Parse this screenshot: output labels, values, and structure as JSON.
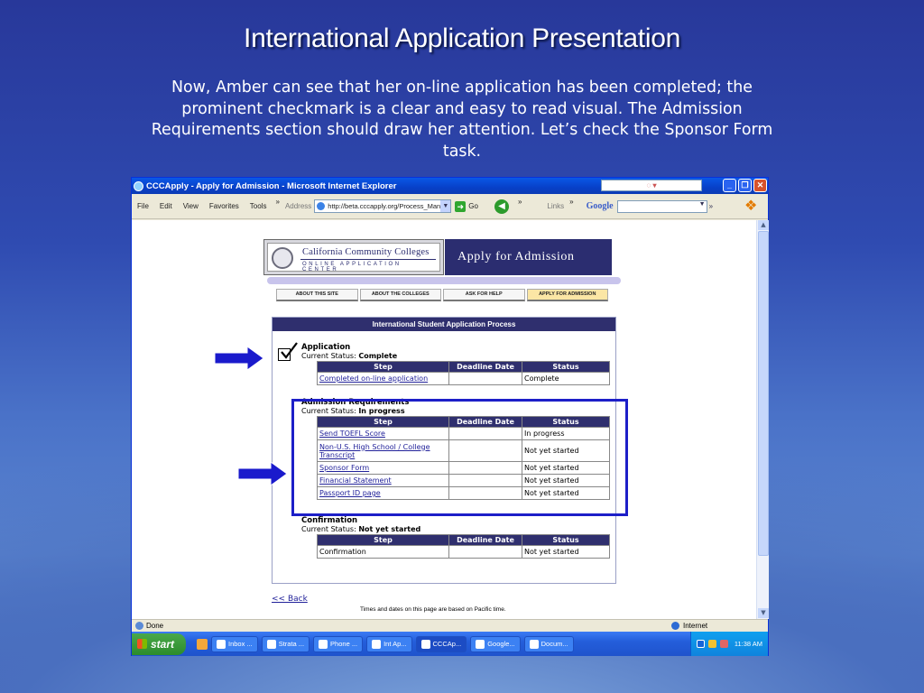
{
  "slide": {
    "title": "International Application Presentation",
    "body": "Now, Amber can see that her on-line application has been completed; the prominent checkmark is a clear and easy to read visual.  The Admission Requirements section should draw her attention.  Let’s check the Sponsor Form task."
  },
  "browser": {
    "title": "CCCApply - Apply for Admission - Microsoft Internet Explorer",
    "menu": [
      "File",
      "Edit",
      "View",
      "Favorites",
      "Tools"
    ],
    "chevron": "»",
    "address_label": "Address",
    "address": "http://beta.cccapply.org/Process_Manag",
    "go": "Go",
    "links": "Links",
    "google": "Google",
    "status_left": "Done",
    "status_zone": "Internet"
  },
  "page": {
    "banner": {
      "org_line1": "California Community Colleges",
      "org_line2": "ONLINE APPLICATION CENTER",
      "title": "Apply for Admission"
    },
    "nav": [
      {
        "label": "ABOUT THIS SITE"
      },
      {
        "label": "ABOUT THE COLLEGES"
      },
      {
        "label": "ASK FOR HELP"
      },
      {
        "label": "APPLY FOR ADMISSION",
        "active": true
      }
    ],
    "panel_title": "International Student Application Process",
    "columns": [
      "Step",
      "Deadline Date",
      "Status"
    ],
    "status_label": "Current Status: ",
    "sections": [
      {
        "heading": "Application",
        "status": "Complete",
        "rows": [
          {
            "step": "Completed on-line application",
            "deadline": "",
            "status": "Complete",
            "link": true
          }
        ]
      },
      {
        "heading": "Admission Requirements",
        "status": "In progress",
        "rows": [
          {
            "step": "Send TOEFL Score",
            "deadline": "",
            "status": "In progress",
            "link": true
          },
          {
            "step": "Non-U.S. High School / College Transcript",
            "deadline": "",
            "status": "Not yet started",
            "link": true
          },
          {
            "step": "Sponsor Form",
            "deadline": "",
            "status": "Not yet started",
            "link": true
          },
          {
            "step": "Financial Statement",
            "deadline": "",
            "status": "Not yet started",
            "link": true
          },
          {
            "step": "Passport ID page",
            "deadline": "",
            "status": "Not yet started",
            "link": true
          }
        ]
      },
      {
        "heading": "Confirmation",
        "status": "Not yet started",
        "rows": [
          {
            "step": "Confirmation",
            "deadline": "",
            "status": "Not yet started",
            "link": false
          }
        ]
      }
    ],
    "back_link": "<< Back",
    "footnote": "Times and dates on this page are based on Pacific time."
  },
  "taskbar": {
    "start": "start",
    "tasks": [
      "Inbox ...",
      "Strata ...",
      "Phone ...",
      "Int Ap...",
      "CCCAp...",
      "Google...",
      "Docum..."
    ],
    "active_task": "CCCAp...",
    "clock": "11:38 AM"
  },
  "colors": {
    "navy": "#2f2f6e",
    "highlight": "#1d1fc8",
    "arrow": "#1a1acc"
  }
}
